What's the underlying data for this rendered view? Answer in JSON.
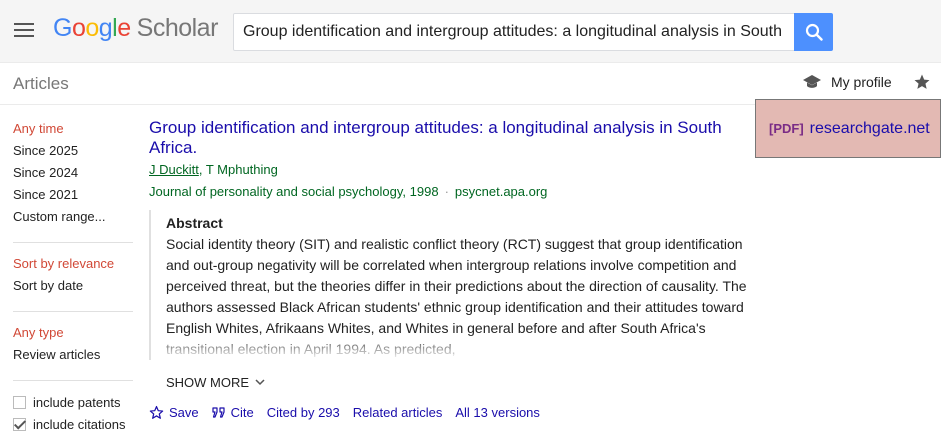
{
  "header": {
    "logo": {
      "g": "G",
      "o1": "o",
      "o2": "o",
      "g2": "g",
      "l": "l",
      "e": "e",
      "scholar": "Scholar"
    },
    "search_value": "Group identification and intergroup attitudes: a longitudinal analysis in South Africa",
    "icons": {
      "menu": "menu-icon",
      "search": "search-icon"
    }
  },
  "subheader": {
    "articles_label": "Articles",
    "profile_label": "My profile",
    "icons": {
      "profile": "graduation-cap-icon",
      "library": "star-icon"
    }
  },
  "sidebar": {
    "time_filters": [
      "Any time",
      "Since 2025",
      "Since 2024",
      "Since 2021",
      "Custom range..."
    ],
    "sort_options": [
      "Sort by relevance",
      "Sort by date"
    ],
    "type_options": [
      "Any type",
      "Review articles"
    ],
    "include_patents": {
      "label": "include patents",
      "checked": false
    },
    "include_citations": {
      "label": "include citations",
      "checked": true
    }
  },
  "result": {
    "title": "Group identification and intergroup attitudes: a longitudinal analysis in South Africa.",
    "author1": "J Duckitt",
    "author_sep": ", ",
    "author2": "T Mphuthing",
    "journal": "Journal of personality and social psychology, 1998",
    "dot": "·",
    "source": "psycnet.apa.org",
    "abstract_heading": "Abstract",
    "abstract_text": "Social identity theory (SIT) and realistic conflict theory (RCT) suggest that group identification and out-group negativity will be correlated when intergroup relations involve competition and perceived threat, but the theories differ in their predictions about the direction of causality. The authors assessed Black African students' ethnic group identification and their attitudes toward English Whites, Afrikaans Whites, and Whites in general before and after South Africa's transitional election in April 1994. As predicted,",
    "show_more": "SHOW MORE",
    "actions": {
      "save": "Save",
      "cite": "Cite",
      "cited_by": "Cited by 293",
      "related": "Related articles",
      "versions": "All 13 versions"
    },
    "pdf": {
      "tag": "[PDF]",
      "site": "researchgate.net"
    }
  },
  "colors": {
    "link": "#1a0dab",
    "green": "#006621",
    "selected": "#d14836",
    "search_button": "#4d90fe",
    "pdf_highlight": "#e3b9b3"
  }
}
